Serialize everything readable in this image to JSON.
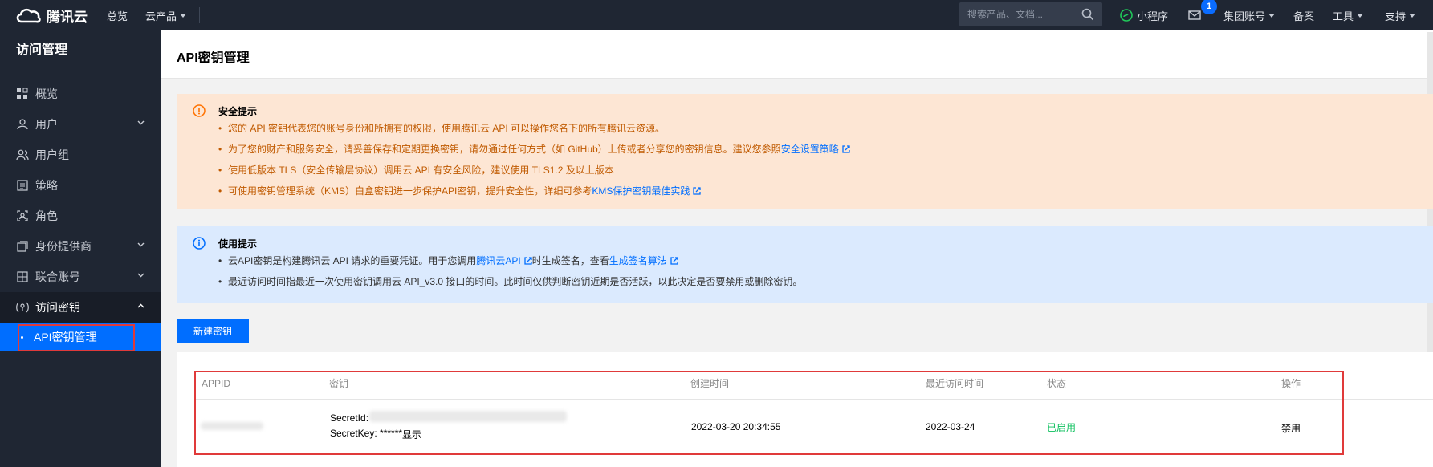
{
  "topbar": {
    "logo_text": "腾讯云",
    "nav": [
      {
        "label": "总览",
        "has_caret": false
      },
      {
        "label": "云产品",
        "has_caret": true
      }
    ],
    "search_placeholder": "搜索产品、文档...",
    "miniprogram_label": "小程序",
    "mail_badge": "1",
    "account_label": "集团账号",
    "beian_label": "备案",
    "tools_label": "工具",
    "support_label": "支持"
  },
  "sidebar": {
    "title": "访问管理",
    "items": [
      {
        "label": "概览",
        "icon": "grid-icon",
        "expandable": false
      },
      {
        "label": "用户",
        "icon": "user-icon",
        "expandable": true
      },
      {
        "label": "用户组",
        "icon": "user-group-icon",
        "expandable": false
      },
      {
        "label": "策略",
        "icon": "policy-icon",
        "expandable": false
      },
      {
        "label": "角色",
        "icon": "role-icon",
        "expandable": false
      },
      {
        "label": "身份提供商",
        "icon": "identity-provider-icon",
        "expandable": true
      },
      {
        "label": "联合账号",
        "icon": "federated-account-icon",
        "expandable": true
      },
      {
        "label": "访问密钥",
        "icon": "access-key-icon",
        "expandable": true,
        "open": true
      }
    ],
    "sub_active": "API密钥管理"
  },
  "page": {
    "title": "API密钥管理"
  },
  "security_notice": {
    "title": "安全提示",
    "lines": [
      {
        "text": "您的 API 密钥代表您的账号身份和所拥有的权限，使用腾讯云 API 可以操作您名下的所有腾讯云资源。"
      },
      {
        "text": "为了您的财产和服务安全，请妥善保存和定期更换密钥，请勿通过任何方式（如 GitHub）上传或者分享您的密钥信息。建议您参照",
        "link": "安全设置策略"
      },
      {
        "text": "使用低版本 TLS（安全传输层协议）调用云 API 有安全风险，建议使用 TLS1.2 及以上版本"
      },
      {
        "text": "可使用密钥管理系统（KMS）白盒密钥进一步保护API密钥，提升安全性，详细可参考",
        "link": "KMS保护密钥最佳实践"
      }
    ]
  },
  "usage_notice": {
    "title": "使用提示",
    "line1_a": "云API密钥是构建腾讯云 API 请求的重要凭证。用于您调用",
    "line1_link1": "腾讯云API",
    "line1_b": "时生成签名，查看",
    "line1_link2": "生成签名算法",
    "line2": "最近访问时间指最近一次使用密钥调用云 API_v3.0 接口的时间。此时间仅供判断密钥近期是否活跃，以此决定是否要禁用或删除密钥。"
  },
  "new_key_button": "新建密钥",
  "table": {
    "columns": [
      "APPID",
      "密钥",
      "创建时间",
      "最近访问时间",
      "状态",
      "操作"
    ],
    "row": {
      "secret_id_label": "SecretId:",
      "secret_key_label": "SecretKey: ******",
      "show_link": "显示",
      "created": "2022-03-20 20:34:55",
      "last_access": "2022-03-24",
      "status": "已启用",
      "action": "禁用"
    }
  },
  "colors": {
    "topbar_bg": "#1f2633",
    "accent": "#006eff",
    "warning_bg": "#fde6d4",
    "warning_text": "#c05a00",
    "info_bg": "#dbeafe",
    "status_green": "#0abf5b",
    "highlight_red": "#e03a3a"
  }
}
